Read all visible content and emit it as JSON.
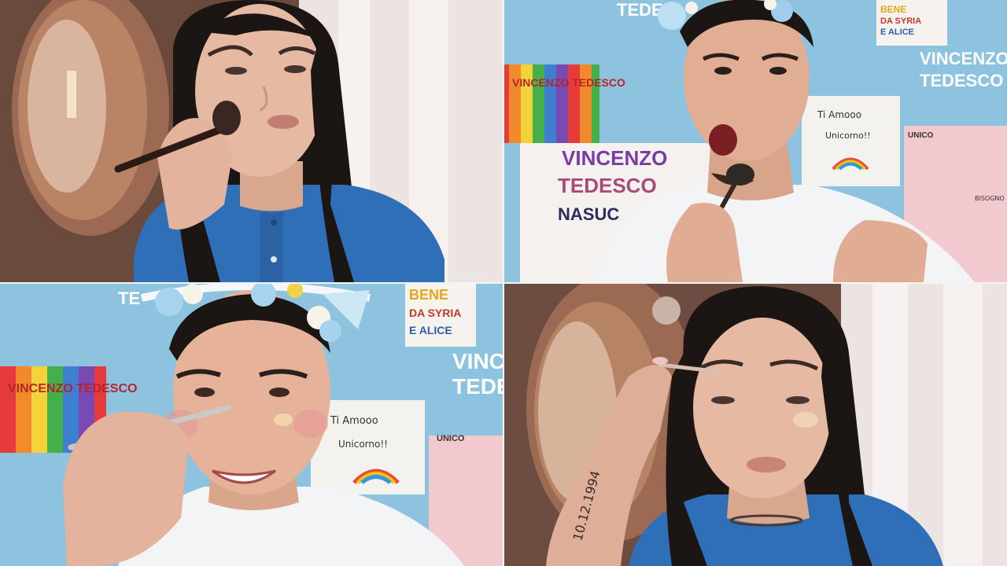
{
  "tiles": {
    "top_right": {
      "wall_labels": {
        "rainbow_flag": "VINCENZO TEDESCO",
        "big_name_line1": "VINCENZO",
        "big_name_line2": "TEDESCO",
        "vertical_word": "NASUC",
        "corner_name_line1": "VINCENZO",
        "corner_name_line2": "TEDESCO",
        "bene_line1": "BENE",
        "bene_line2": "DA SYRIA",
        "bene_line3": "E ALICE",
        "note_text": "Ti Amooo",
        "note_text2": "Unicorno!!",
        "unico_label": "UNICO",
        "top_partial": "TEDE",
        "pink_note": "BISOGNO"
      }
    },
    "bottom_left": {
      "wall_labels": {
        "bene_line1": "BENE",
        "bene_line2": "DA SYRIA",
        "bene_line3": "E ALICE",
        "vince_line1": "VINCE",
        "vince_line2": "TEDE",
        "flag_text": "VINCENZO TEDESCO",
        "note_text": "Ti Amooo",
        "note_text2": "Unicorno!!",
        "unico_label": "UNICO",
        "top_partial": "TE"
      }
    },
    "bottom_right": {
      "tattoo_text": "10.12.1994"
    }
  },
  "colors": {
    "wall_blue": "#8ec3df",
    "shirt_blue": "#2f6fb8",
    "hair": "#1b1514",
    "skin": "#e2b39c",
    "mirror_frame": "#8a5a44",
    "curtain": "#efe8e6"
  }
}
